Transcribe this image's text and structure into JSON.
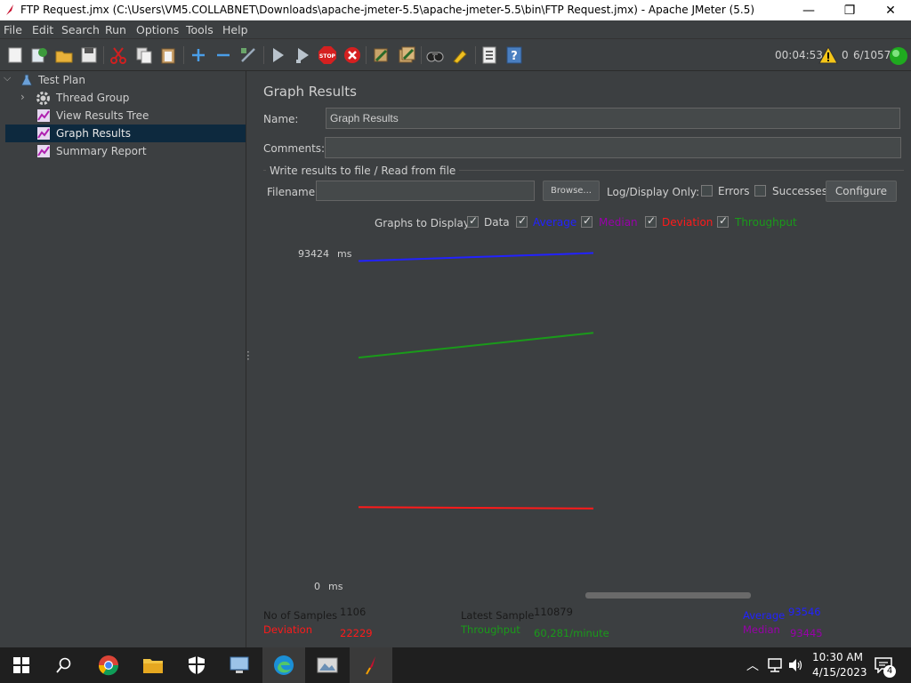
{
  "window": {
    "title": "FTP Request.jmx (C:\\Users\\VM5.COLLABNET\\Downloads\\apache-jmeter-5.5\\apache-jmeter-5.5\\bin\\FTP Request.jmx) - Apache JMeter (5.5)",
    "minimize": "—",
    "maximize": "❐",
    "close": "✕"
  },
  "menu": [
    "File",
    "Edit",
    "Search",
    "Run",
    "Options",
    "Tools",
    "Help"
  ],
  "toolbar": {
    "elapsed": "00:04:53",
    "warnings": "0",
    "threads": "6/1057"
  },
  "tree": {
    "items": [
      {
        "label": "Test Plan",
        "icon": "test-plan-icon"
      },
      {
        "label": "Thread Group",
        "icon": "gear-icon"
      },
      {
        "label": "View Results Tree",
        "icon": "chart-icon"
      },
      {
        "label": "Graph Results",
        "icon": "chart-icon"
      },
      {
        "label": "Summary Report",
        "icon": "chart-icon"
      }
    ]
  },
  "panel": {
    "title": "Graph Results",
    "name_label": "Name:",
    "name_value": "Graph Results",
    "comments_label": "Comments:",
    "comments_value": "",
    "file_section": "Write results to file / Read from file",
    "filename_label": "Filename",
    "filename_value": "",
    "browse": "Browse...",
    "log_display_label": "Log/Display Only:",
    "errors_label": "Errors",
    "successes_label": "Successes",
    "configure": "Configure",
    "graphs_label": "Graphs to Display",
    "graphs": [
      {
        "label": "Data",
        "color": "#cfcfcf",
        "checked": true
      },
      {
        "label": "Average",
        "color": "#2222ff",
        "checked": true
      },
      {
        "label": "Median",
        "color": "#9900aa",
        "checked": true
      },
      {
        "label": "Deviation",
        "color": "#ff1a1a",
        "checked": true
      },
      {
        "label": "Throughput",
        "color": "#1a9a1a",
        "checked": true
      }
    ]
  },
  "chart_data": {
    "type": "line",
    "y_max_label": "93424",
    "y_min_label": "0",
    "y_unit": "ms",
    "ylim": [
      0,
      93424
    ],
    "x": [
      1,
      1106
    ],
    "series": [
      {
        "name": "Average",
        "color": "#2222ff",
        "values": [
          91300,
          93546
        ]
      },
      {
        "name": "Throughput",
        "color": "#1a9a1a",
        "values": [
          64000,
          71000
        ]
      },
      {
        "name": "Deviation",
        "color": "#ff1a1a",
        "values": [
          21800,
          21400
        ]
      }
    ]
  },
  "stats": {
    "samples_label": "No of Samples",
    "samples_value": "1106",
    "latest_label": "Latest Sample",
    "latest_value": "110879",
    "average_label": "Average",
    "average_value": "93546",
    "deviation_label": "Deviation",
    "deviation_value": "22229",
    "throughput_label": "Throughput",
    "throughput_value": "60,281/minute",
    "median_label": "Median",
    "median_value": "93445"
  },
  "taskbar": {
    "time": "10:30 AM",
    "date": "4/15/2023",
    "notifications": "4"
  }
}
